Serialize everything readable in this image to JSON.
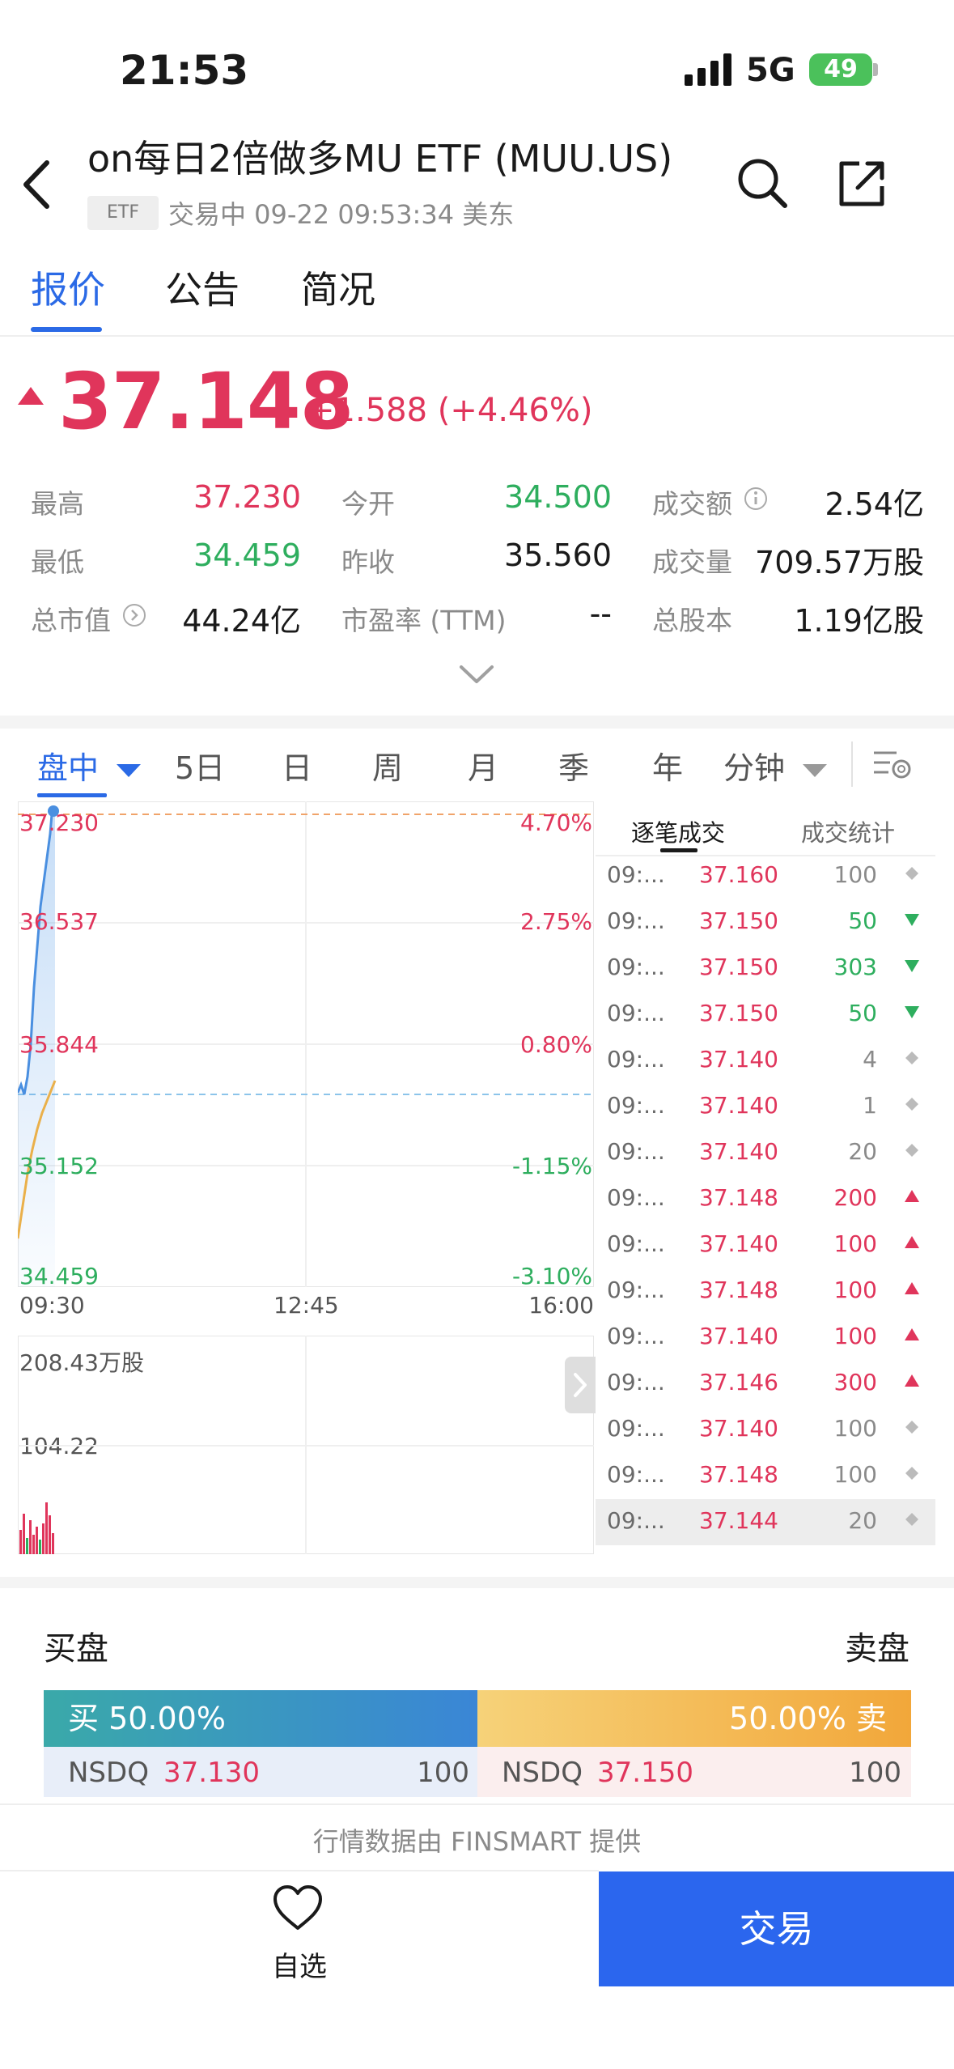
{
  "status_bar": {
    "time": "21:53",
    "network": "5G",
    "battery": "49"
  },
  "header": {
    "title": "on每日2倍做多MU ETF  (MUU.US)",
    "badge": "ETF",
    "subtitle": "交易中 09-22 09:53:34  美东"
  },
  "tabs": [
    "报价",
    "公告",
    "简况"
  ],
  "quote": {
    "price": "37.148",
    "change": "+1.588  (+4.46%)",
    "stats": [
      {
        "label": "最高",
        "value": "37.230",
        "color": "#e0355b"
      },
      {
        "label": "今开",
        "value": "34.500",
        "color": "#2eae5e"
      },
      {
        "label": "成交额",
        "value": "2.54亿",
        "color": "#1a1a1a"
      },
      {
        "label": "最低",
        "value": "34.459",
        "color": "#2eae5e"
      },
      {
        "label": "昨收",
        "value": "35.560",
        "color": "#1a1a1a"
      },
      {
        "label": "成交量",
        "value": "709.57万股",
        "color": "#1a1a1a"
      },
      {
        "label": "总市值",
        "value": "44.24亿",
        "color": "#1a1a1a"
      },
      {
        "label": "市盈率 (TTM)",
        "value": "--",
        "color": "#1a1a1a"
      },
      {
        "label": "总股本",
        "value": "1.19亿股",
        "color": "#1a1a1a"
      }
    ]
  },
  "period_tabs": [
    "盘中",
    "5日",
    "日",
    "周",
    "月",
    "季",
    "年",
    "分钟"
  ],
  "chart": {
    "price_labels": [
      "37.230",
      "36.537",
      "35.844",
      "35.152",
      "34.459"
    ],
    "pct_labels": [
      "4.70%",
      "2.75%",
      "0.80%",
      "-1.15%",
      "-3.10%"
    ],
    "time_labels": [
      "09:30",
      "12:45",
      "16:00"
    ],
    "volume_labels": [
      "208.43万股",
      "104.22"
    ]
  },
  "trades_panel": {
    "tabs": [
      "逐笔成交",
      "成交统计"
    ],
    "rows": [
      {
        "time": "09:...",
        "price": "37.160",
        "volume": "100",
        "dir": "neutral"
      },
      {
        "time": "09:...",
        "price": "37.150",
        "volume": "50",
        "dir": "down"
      },
      {
        "time": "09:...",
        "price": "37.150",
        "volume": "303",
        "dir": "down"
      },
      {
        "time": "09:...",
        "price": "37.150",
        "volume": "50",
        "dir": "down"
      },
      {
        "time": "09:...",
        "price": "37.140",
        "volume": "4",
        "dir": "neutral"
      },
      {
        "time": "09:...",
        "price": "37.140",
        "volume": "1",
        "dir": "neutral"
      },
      {
        "time": "09:...",
        "price": "37.140",
        "volume": "20",
        "dir": "neutral"
      },
      {
        "time": "09:...",
        "price": "37.148",
        "volume": "200",
        "dir": "up"
      },
      {
        "time": "09:...",
        "price": "37.140",
        "volume": "100",
        "dir": "up"
      },
      {
        "time": "09:...",
        "price": "37.148",
        "volume": "100",
        "dir": "up"
      },
      {
        "time": "09:...",
        "price": "37.140",
        "volume": "100",
        "dir": "up"
      },
      {
        "time": "09:...",
        "price": "37.146",
        "volume": "300",
        "dir": "up"
      },
      {
        "time": "09:...",
        "price": "37.140",
        "volume": "100",
        "dir": "neutral"
      },
      {
        "time": "09:...",
        "price": "37.148",
        "volume": "100",
        "dir": "neutral"
      },
      {
        "time": "09:...",
        "price": "37.144",
        "volume": "20",
        "dir": "neutral"
      }
    ]
  },
  "order_book": {
    "buy_title": "买盘",
    "sell_title": "卖盘",
    "buy_bar": "买 50.00%",
    "sell_bar": "50.00% 卖",
    "buy": {
      "exchange": "NSDQ",
      "price": "37.130",
      "size": "100"
    },
    "sell": {
      "exchange": "NSDQ",
      "price": "37.150",
      "size": "100"
    }
  },
  "footer": {
    "data_source": "行情数据由 FINSMART 提供",
    "watch_label": "自选",
    "trade_label": "交易"
  },
  "colors": {
    "up": "#e0355b",
    "down": "#2eae5e",
    "accent": "#2b6ae6",
    "neutral": "#bbbbbb"
  }
}
